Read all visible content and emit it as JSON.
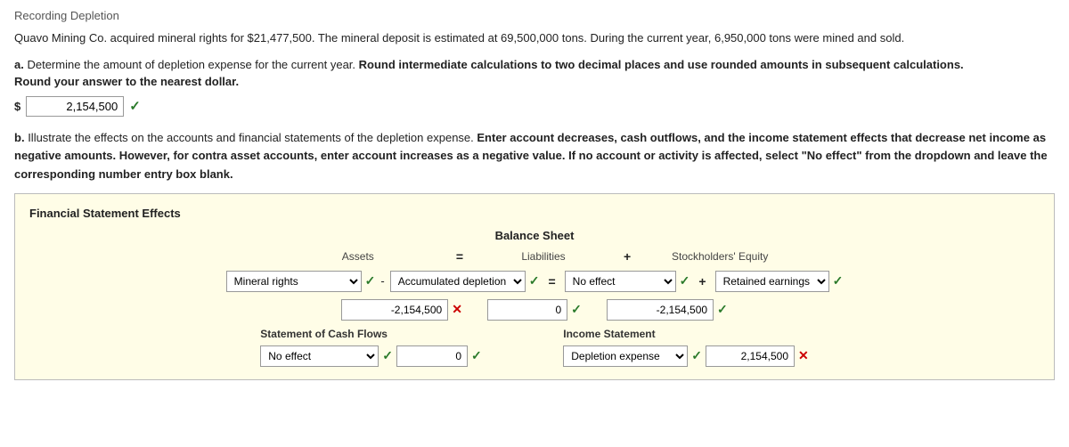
{
  "page": {
    "title": "Recording Depletion"
  },
  "intro": {
    "text": "Quavo Mining Co. acquired mineral rights for $21,477,500. The mineral deposit is estimated at 69,500,000 tons. During the current year, 6,950,000 tons were mined and sold."
  },
  "part_a": {
    "label": "a.",
    "instruction": "Determine the amount of depletion expense for the current year. Round intermediate calculations to two decimal places and use rounded amounts in subsequent calculations.",
    "sub_instruction": "Round your answer to the nearest dollar.",
    "dollar_sign": "$",
    "answer_value": "2,154,500",
    "check": "✓"
  },
  "part_b": {
    "label": "b.",
    "instruction": "Illustrate the effects on the accounts and financial statements of the depletion expense. Enter account decreases, cash outflows, and the income statement effects that decrease net income as negative amounts. However, for contra asset accounts, enter account increases as a negative value. If no account or activity is affected, select \"No effect\" from the dropdown and leave the corresponding number entry box blank."
  },
  "fse": {
    "title": "Financial Statement Effects",
    "balance_sheet": {
      "header": "Balance Sheet",
      "assets_label": "Assets",
      "equals": "=",
      "liabilities_label": "Liabilities",
      "plus": "+",
      "equity_label": "Stockholders' Equity",
      "asset1": {
        "dropdown_value": "Mineral rights",
        "check": "✓",
        "minus": "-",
        "dropdown2_value": "Accumulated depletion",
        "check2": "✓",
        "equals": "=",
        "input_value": "-2,154,500",
        "x": "✕"
      },
      "liability": {
        "dropdown_value": "No effect",
        "check": "✓",
        "plus": "+",
        "equity_dropdown": "Retained earnings",
        "equity_check": "✓"
      },
      "asset_input": "-2,154,500",
      "asset_x": "✕",
      "liability_input": "0",
      "liability_check": "✓",
      "equity_input": "-2,154,500",
      "equity_check2": "✓"
    },
    "cash_flow": {
      "label": "Statement of Cash Flows",
      "dropdown_value": "No effect",
      "check": "✓",
      "input_value": "0",
      "input_check": "✓"
    },
    "income": {
      "label": "Income Statement",
      "dropdown_value": "Depletion expense",
      "check": "✓",
      "input_value": "2,154,500",
      "input_x": "✕"
    }
  }
}
